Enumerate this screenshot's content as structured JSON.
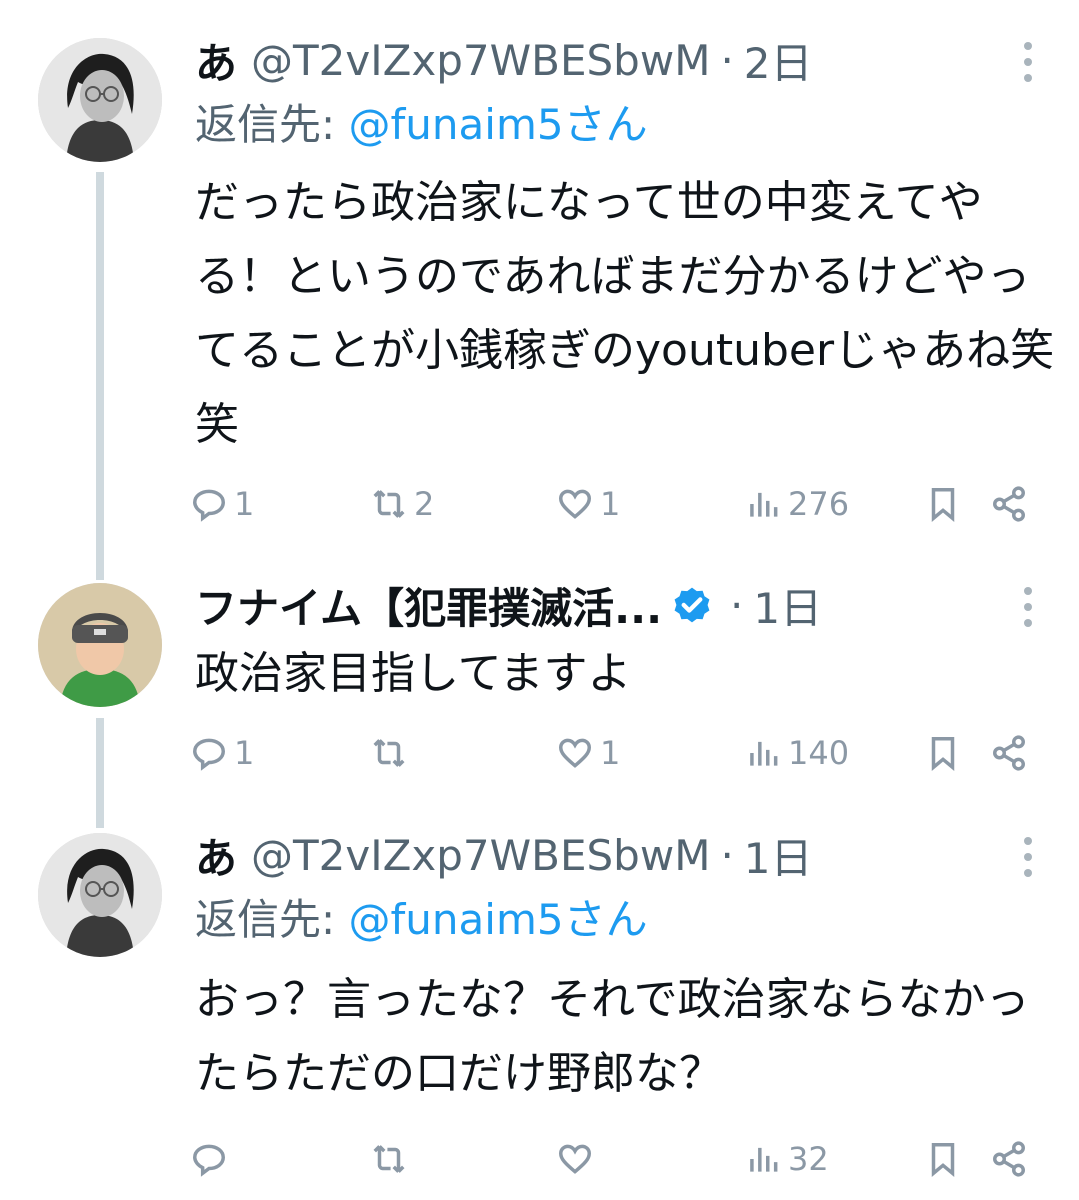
{
  "tweets": [
    {
      "name": "あ",
      "handle": "@T2vIZxp7WBESbwM",
      "separator": "·",
      "time": "2日",
      "reply_prefix": "返信先: ",
      "reply_mention": "@funaim5さん",
      "text": "だったら政治家になって世の中変えてやる！というのであればまだ分かるけどやってることが小銭稼ぎのyoutuberじゃあね笑笑",
      "avatar_icon": "person-photo-icon",
      "stats": {
        "replies": "1",
        "retweets": "2",
        "likes": "1",
        "views": "276"
      }
    },
    {
      "name": "フナイム【犯罪撲滅活...",
      "verified": true,
      "separator": "·",
      "time": "1日",
      "text": "政治家目指してますよ",
      "avatar_icon": "person-photo-icon",
      "stats": {
        "replies": "1",
        "retweets": "",
        "likes": "1",
        "views": "140"
      }
    },
    {
      "name": "あ",
      "handle": "@T2vIZxp7WBESbwM",
      "separator": "·",
      "time": "1日",
      "reply_prefix": "返信先: ",
      "reply_mention": "@funaim5さん",
      "text": "おっ？言ったな？それで政治家ならなかったらただの口だけ野郎な？",
      "avatar_icon": "person-photo-icon",
      "stats": {
        "replies": "",
        "retweets": "",
        "likes": "",
        "views": "32"
      }
    }
  ],
  "colors": {
    "text": "#0f1419",
    "secondary": "#536471",
    "link": "#1d9bf0",
    "icon": "#8b98a5",
    "thread_line": "#cfd9de"
  }
}
